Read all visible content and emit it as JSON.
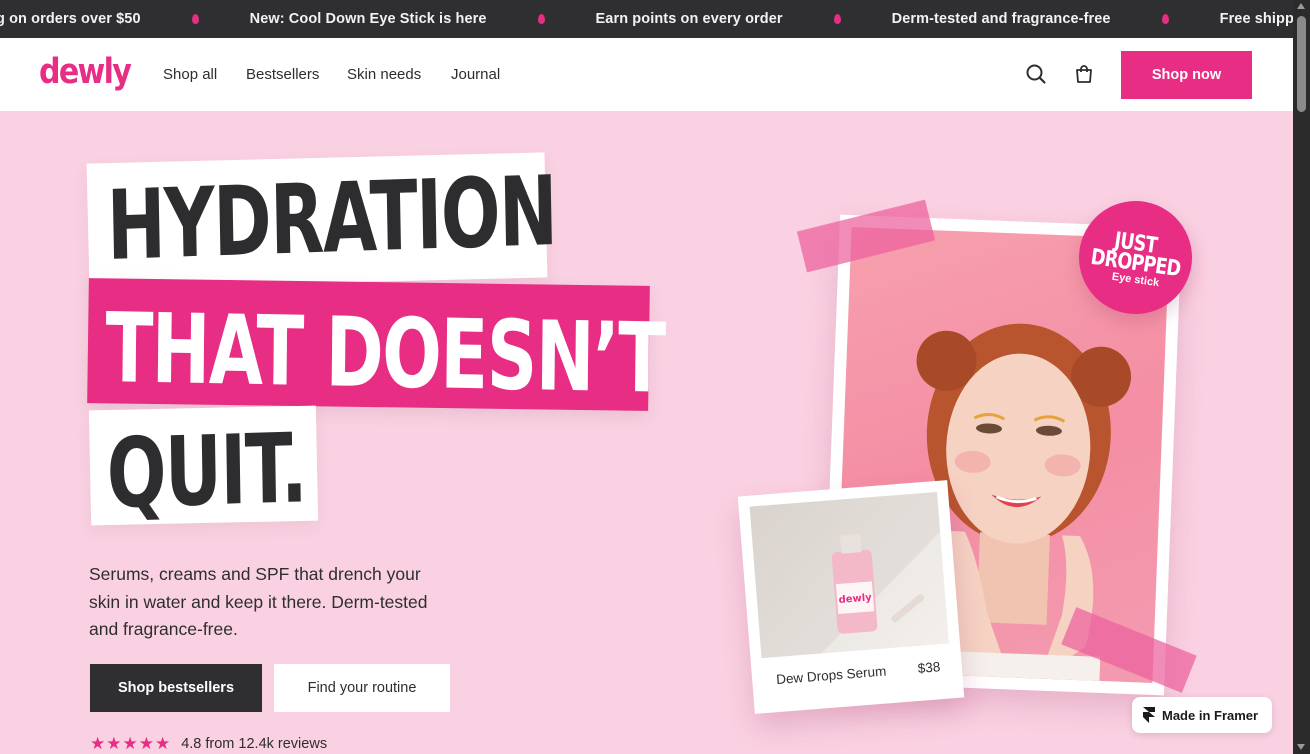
{
  "announcement": {
    "items": [
      "g on orders over $50",
      "New: Cool Down Eye Stick is here",
      "Earn points on every order",
      "Derm-tested and fragrance-free",
      "Free shipping on o"
    ]
  },
  "nav": {
    "logo": "dewly",
    "links": [
      "Shop all",
      "Bestsellers",
      "Skin needs",
      "Journal"
    ],
    "cta": "Shop now",
    "icons": [
      "search-icon",
      "bag-icon"
    ]
  },
  "hero": {
    "headline": [
      "HYDRATION",
      "THAT DOESN’T",
      "QUIT."
    ],
    "subtext": "Serums, creams and SPF that drench your skin in water and keep it there. Derm-tested and fragrance-free.",
    "primary_cta": "Shop bestsellers",
    "secondary_cta": "Find your routine",
    "rating": {
      "stars": 5,
      "text": "4.8 from 12.4k reviews"
    }
  },
  "collage": {
    "badge": [
      "JUST",
      "DROPPED",
      "Eye stick"
    ],
    "bottle_label": "dewly",
    "product_name": "Dew Drops Serum",
    "product_price": "$38"
  },
  "framer_badge": "Made in Framer",
  "colors": {
    "accent": "#e72d84",
    "dark": "#2f2f31",
    "background": "#fad1e2"
  }
}
